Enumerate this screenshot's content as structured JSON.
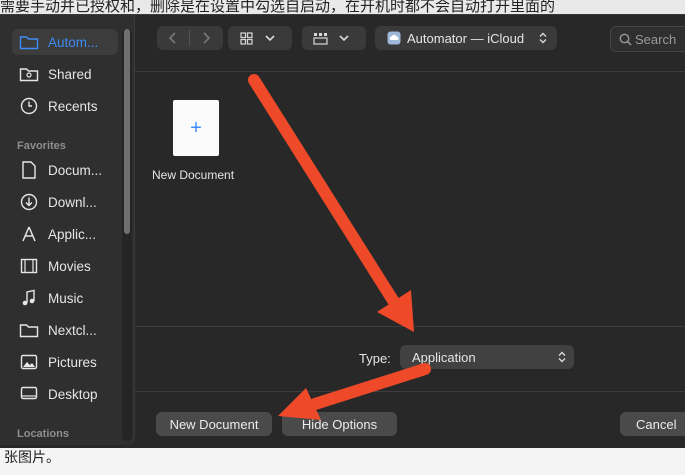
{
  "background": {
    "top_text": "需要手动并已授权和，删除是在设置中勾选自启动，在开机时都不会自动打开里面的",
    "bottom_text": "张图片。"
  },
  "sidebar": {
    "items_top": [
      {
        "label": "Autom...",
        "icon": "folder-icon",
        "selected": true
      },
      {
        "label": "Shared",
        "icon": "shared-folder-icon"
      },
      {
        "label": "Recents",
        "icon": "clock-icon"
      }
    ],
    "favorites_header": "Favorites",
    "favorites": [
      {
        "label": "Docum...",
        "icon": "document-icon"
      },
      {
        "label": "Downl...",
        "icon": "download-icon"
      },
      {
        "label": "Applic...",
        "icon": "applications-icon"
      },
      {
        "label": "Movies",
        "icon": "film-icon"
      },
      {
        "label": "Music",
        "icon": "music-icon"
      },
      {
        "label": "Nextcl...",
        "icon": "folder-icon"
      },
      {
        "label": "Pictures",
        "icon": "pictures-icon"
      },
      {
        "label": "Desktop",
        "icon": "desktop-icon"
      }
    ],
    "locations_header": "Locations"
  },
  "toolbar": {
    "location": "Automator — iCloud",
    "search_placeholder": "Search"
  },
  "content": {
    "items": [
      {
        "label": "New Document",
        "icon": "plus-icon"
      }
    ]
  },
  "options": {
    "type_label": "Type:",
    "type_value": "Application"
  },
  "buttons": {
    "new_document": "New Document",
    "hide_options": "Hide Options",
    "cancel": "Cancel"
  },
  "colors": {
    "accent": "#3d8cf5",
    "annotation_arrow": "#ee4a2a"
  }
}
